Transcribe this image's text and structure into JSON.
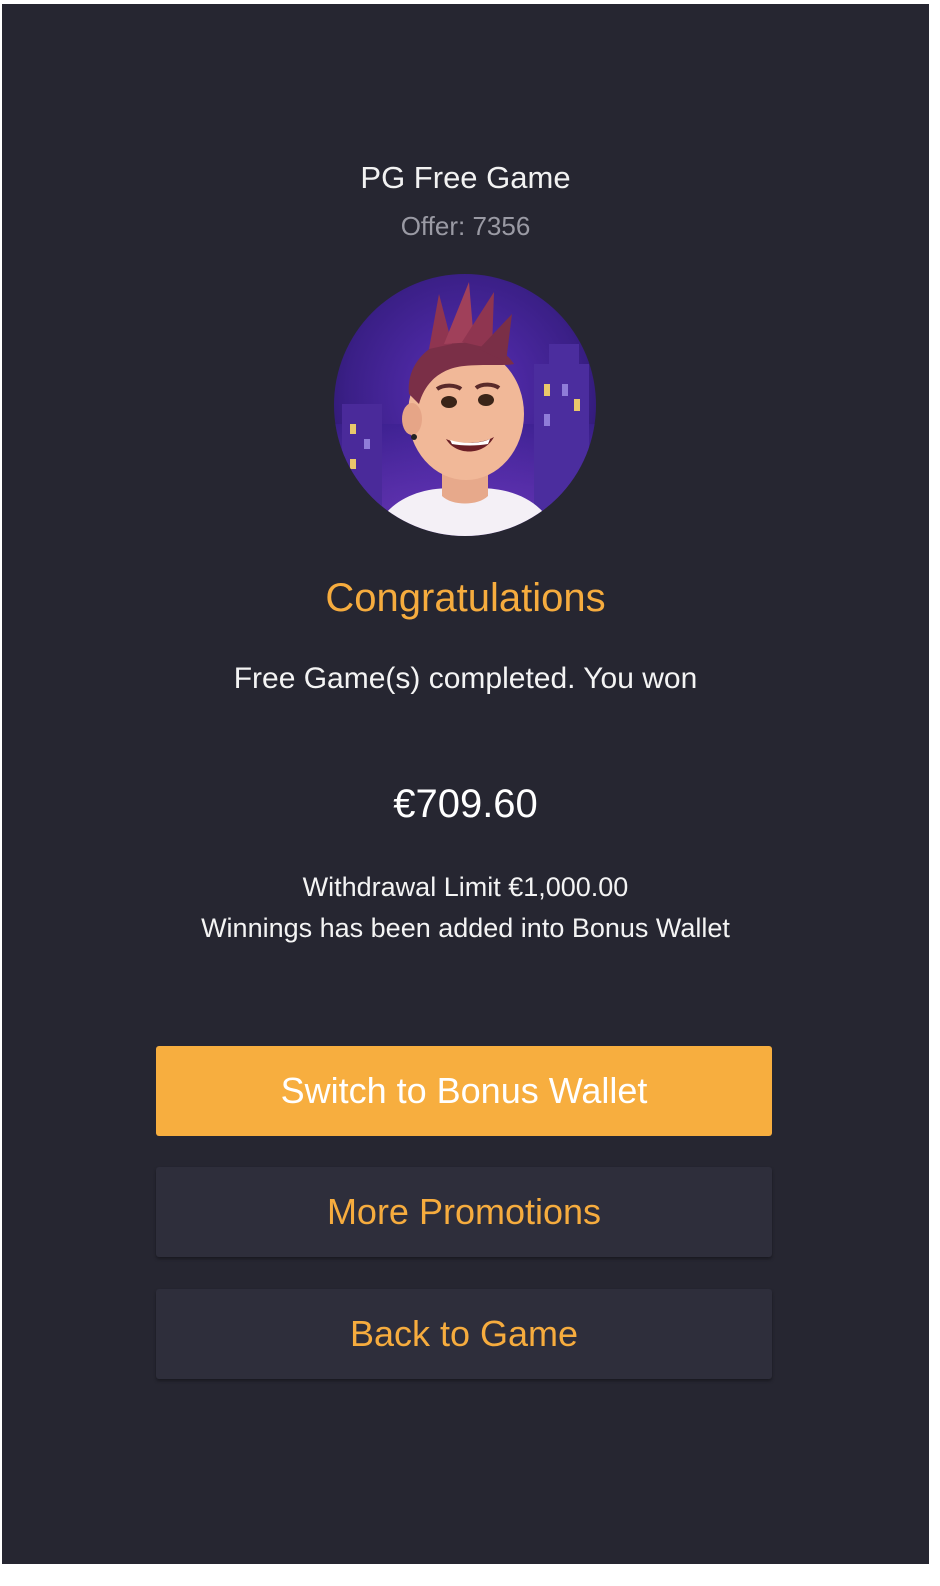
{
  "header": {
    "title": "PG Free Game",
    "offer": "Offer: 7356"
  },
  "avatar": {
    "icon": "game-character-avatar"
  },
  "result": {
    "heading": "Congratulations",
    "message": "Free Game(s) completed. You won",
    "amount": "€709.60",
    "withdrawal_limit": "Withdrawal Limit €1,000.00",
    "notice": "Winnings has been added into Bonus Wallet"
  },
  "actions": {
    "switch_label": "Switch to Bonus Wallet",
    "promotions_label": "More Promotions",
    "back_label": "Back to Game"
  },
  "colors": {
    "background": "#262631",
    "accent": "#f7ae3f",
    "secondary_button": "#2e2e3b"
  }
}
